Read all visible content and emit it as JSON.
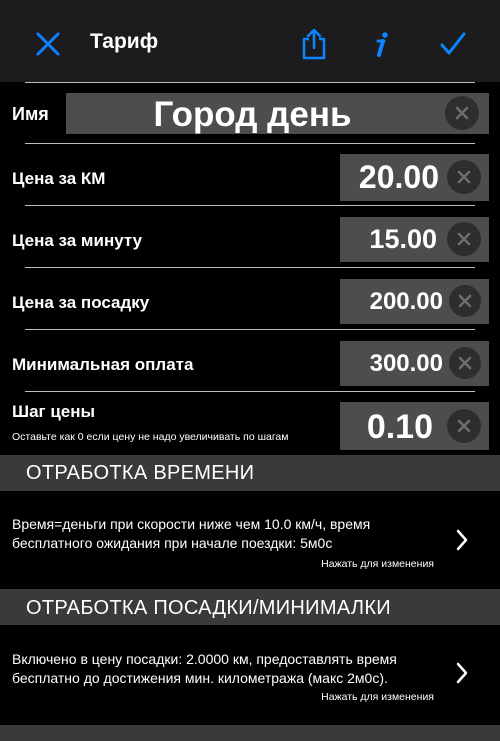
{
  "nav": {
    "title": "Тариф",
    "close_icon": "close-icon",
    "share_icon": "share-icon",
    "info_icon": "info-icon",
    "confirm_icon": "checkmark-icon",
    "accent": "#0a84ff"
  },
  "name_field": {
    "label": "Имя",
    "value": "Город день"
  },
  "fields": [
    {
      "label": "Цена за КМ",
      "value": "20.00"
    },
    {
      "label": "Цена за минуту",
      "value": "15.00"
    },
    {
      "label": "Цена за посадку",
      "value": "200.00"
    },
    {
      "label": "Минимальная оплата",
      "value": "300.00"
    },
    {
      "label": "Шаг цены",
      "sublabel": "Оставьте как 0 если цену не надо увеличивать по шагам",
      "value": "0.10"
    }
  ],
  "sections": [
    {
      "title": "ОТРАБОТКА ВРЕМЕНИ",
      "description": "Время=деньги при скорости ниже чем 10.0 км/ч, время бесплатного ожидания при начале поездки: 5м0с",
      "hint": "Нажать для изменения"
    },
    {
      "title": "ОТРАБОТКА ПОСАДКИ/МИНИМАЛКИ",
      "description": "Включено в цену посадки: 2.0000 км, предоставлять время бесплатно до достижения мин. километража (макс 2м0с).",
      "hint": "Нажать для изменения"
    }
  ],
  "colors": {
    "background": "#000000",
    "nav_bar": "#1c1c1e",
    "field": "#4d4d4d",
    "section_header": "#3a3a3c"
  }
}
